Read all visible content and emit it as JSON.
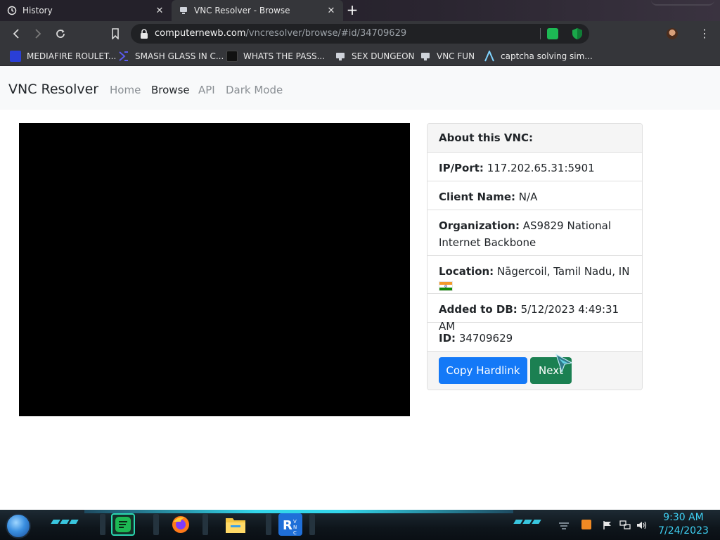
{
  "browser": {
    "tabs": [
      {
        "title": "History",
        "icon": "history-icon",
        "active": false
      },
      {
        "title": "VNC Resolver - Browse",
        "icon": "vnc-favicon-icon",
        "active": true
      }
    ],
    "url_host": "computernewb.com",
    "url_path": "/vncresolver/browse/#id/34709629",
    "bookmarks": [
      {
        "label": "MEDIAFIRE ROULET...",
        "icon": "mediafire-icon",
        "color": "#2a3fd6"
      },
      {
        "label": "SMASH GLASS IN C...",
        "icon": "smash-glass-icon",
        "color": "#5b3fd6"
      },
      {
        "label": "WHATS THE PASS...",
        "icon": "whats-the-pass-icon",
        "color": "#111111"
      },
      {
        "label": "SEX DUNGEON",
        "icon": "vnc-favicon-icon",
        "color": "#cfd3da"
      },
      {
        "label": "VNC FUN",
        "icon": "vnc-favicon-icon",
        "color": "#cfd3da"
      },
      {
        "label": "captcha solving sim...",
        "icon": "captcha-icon",
        "color": "#7fd3ff"
      }
    ]
  },
  "site": {
    "brand": "VNC Resolver",
    "nav": [
      {
        "label": "Home",
        "active": false
      },
      {
        "label": "Browse",
        "active": true
      },
      {
        "label": "API",
        "active": false
      },
      {
        "label": "Dark Mode",
        "active": false
      }
    ]
  },
  "vnc": {
    "header": "About this VNC:",
    "ip_label": "IP/Port:",
    "ip_value": "117.202.65.31:5901",
    "client_label": "Client Name:",
    "client_value": "N/A",
    "org_label": "Organization:",
    "org_value": "AS9829 National Internet Backbone",
    "location_label": "Location:",
    "location_value": "Nāgercoil, Tamil Nadu, IN",
    "location_flag": "india-flag-icon",
    "added_label": "Added to DB:",
    "added_value": "5/12/2023 4:49:31 AM",
    "id_label": "ID:",
    "id_value": "34709629",
    "copy_button": "Copy Hardlink",
    "next_button": "Next"
  },
  "taskbar": {
    "apps": [
      "spotify-icon",
      "firefox-icon",
      "file-explorer-icon",
      "realvnc-icon"
    ],
    "tray": [
      "show-hidden-icon",
      "tray-app-icon",
      "action-center-flag-icon",
      "network-icon",
      "volume-icon"
    ],
    "time": "9:30 AM",
    "date": "7/24/2023"
  },
  "colors": {
    "primary": "#1479f7",
    "success": "#1b8052",
    "clock": "#3fd2f5",
    "accent_glow": "#33d6ea"
  }
}
